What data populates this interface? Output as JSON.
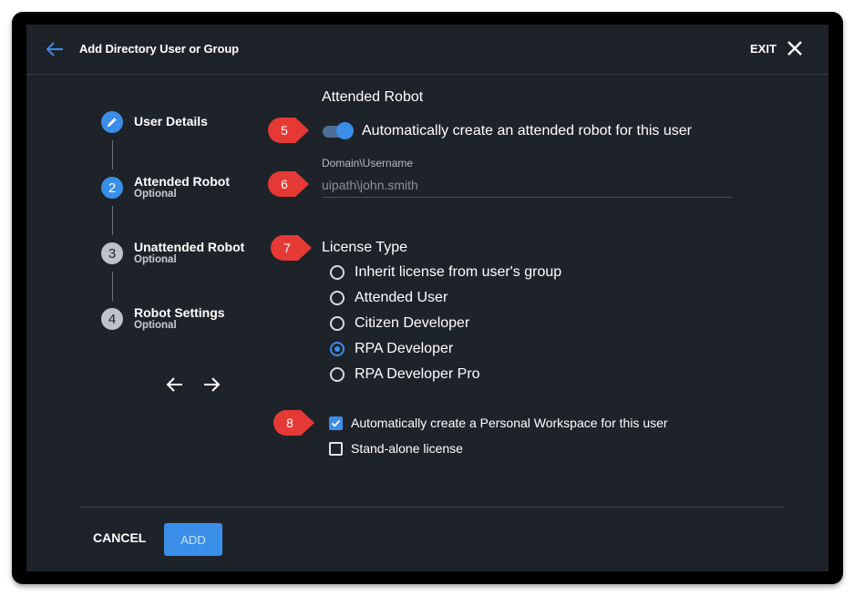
{
  "header": {
    "title": "Add Directory User or Group",
    "exit_label": "EXIT"
  },
  "steps": [
    {
      "number": "",
      "title": "User Details",
      "subtitle": ""
    },
    {
      "number": "2",
      "title": "Attended Robot",
      "subtitle": "Optional"
    },
    {
      "number": "3",
      "title": "Unattended Robot",
      "subtitle": "Optional"
    },
    {
      "number": "4",
      "title": "Robot Settings",
      "subtitle": "Optional"
    }
  ],
  "attended": {
    "section_title": "Attended Robot",
    "toggle_label": "Automatically create an attended robot for this user",
    "toggle_on": true,
    "field_label": "Domain\\Username",
    "field_placeholder": "uipath\\john.smith"
  },
  "license": {
    "title": "License Type",
    "options": [
      "Inherit license from user's group",
      "Attended User",
      "Citizen Developer",
      "RPA Developer",
      "RPA Developer Pro"
    ],
    "selected": "RPA Developer"
  },
  "checkboxes": [
    {
      "label": "Automatically create a Personal Workspace for this user",
      "checked": true
    },
    {
      "label": "Stand-alone license",
      "checked": false
    }
  ],
  "markers": [
    "5",
    "6",
    "7",
    "8"
  ],
  "footer": {
    "cancel_label": "CANCEL",
    "add_label": "ADD"
  },
  "colors": {
    "accent": "#3a8ee8",
    "panel_bg": "#1e2329",
    "marker": "#e53935"
  }
}
